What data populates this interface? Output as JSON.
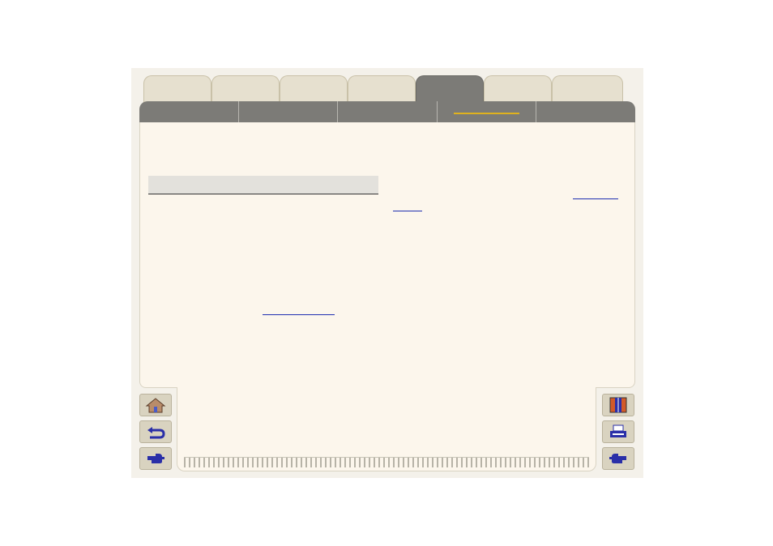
{
  "tabs": [
    {
      "label": "",
      "active": false
    },
    {
      "label": "",
      "active": false
    },
    {
      "label": "",
      "active": false
    },
    {
      "label": "",
      "active": false
    },
    {
      "label": "",
      "active": true
    },
    {
      "label": "",
      "active": false
    },
    {
      "label": "",
      "active": false
    }
  ],
  "subtabs": [
    {
      "label": "",
      "active": false
    },
    {
      "label": "",
      "active": false
    },
    {
      "label": "",
      "active": false
    },
    {
      "label": "",
      "active": true
    },
    {
      "label": "",
      "active": false
    }
  ],
  "icons": {
    "left": [
      "home-icon",
      "back-icon",
      "forward-icon"
    ],
    "right": [
      "contents-icon",
      "print-icon",
      "next-page-icon"
    ]
  },
  "colors": {
    "page": "#fcf6ec",
    "tab": "#e6e0cf",
    "active_tab": "#7c7b77",
    "accent": "#e0b21e",
    "link": "#1f2fb0",
    "icon": "#2a2fa8"
  }
}
